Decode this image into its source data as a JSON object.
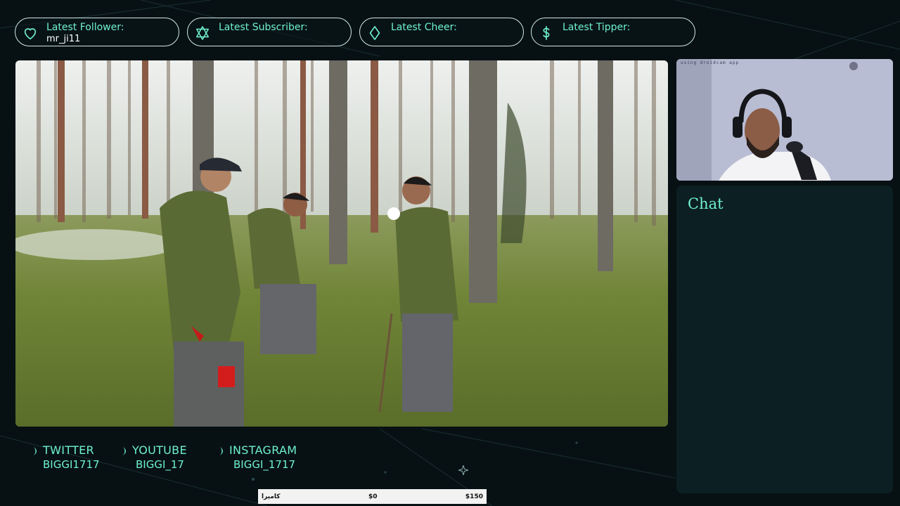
{
  "alerts": [
    {
      "label": "Latest Follower:",
      "value": "mr_ji11",
      "icon": "heart-icon"
    },
    {
      "label": "Latest Subscriber:",
      "value": "",
      "icon": "star-of-david-icon"
    },
    {
      "label": "Latest Cheer:",
      "value": "",
      "icon": "diamond-icon"
    },
    {
      "label": "Latest Tipper:",
      "value": "",
      "icon": "dollar-icon"
    }
  ],
  "webcam": {
    "overlay_text": "using droidcam app"
  },
  "chat": {
    "title": "Chat"
  },
  "socials": [
    {
      "name": "TWITTER",
      "handle": "BIGGI1717",
      "icon": "crescent-icon"
    },
    {
      "name": "YOUTUBE",
      "handle": "BIGGI_17",
      "icon": "crescent-icon"
    },
    {
      "name": "INSTAGRAM",
      "handle": "BIGGI_1717",
      "icon": "crescent-icon"
    }
  ],
  "goal": {
    "label": "كاميرا",
    "current": "$0",
    "target": "$150"
  },
  "colors": {
    "accent": "#6ff1cf",
    "background": "#071114",
    "panel": "#0c1f22",
    "pill_border": "#cfe9e2"
  }
}
